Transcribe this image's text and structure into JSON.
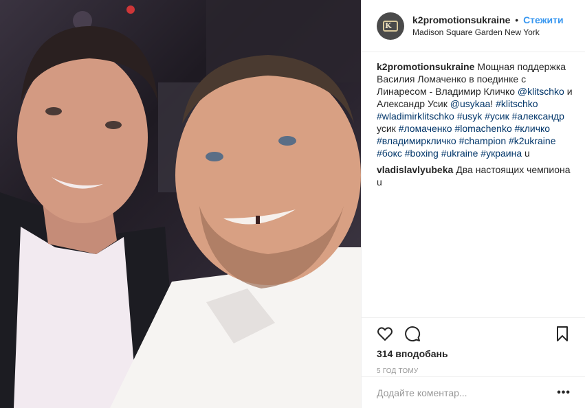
{
  "header": {
    "username": "k2promotionsukraine",
    "separator": "•",
    "follow_label": "Стежити",
    "location": "Madison Square Garden New York"
  },
  "caption": {
    "username": "k2promotionsukraine",
    "text_before": "Мощная поддержка Василия Ломаченко в поединке с Линаресом - Владимир Кличко ",
    "mention1": "@klitschko",
    "text_mid": " и Александр Усик ",
    "mention2": "@usykaa",
    "text_after": "! ",
    "hashtags": [
      "#klitschko",
      "#wladimirklitschko",
      "#usyk",
      "#усик",
      "#александр",
      "усик",
      "#ломаченко",
      "#lomachenko",
      "#кличко",
      "#владимиркличко",
      "#champion",
      "#k2ukraine",
      "#бокс",
      "#boxing",
      "#ukraine",
      "#украина"
    ],
    "end_text": "u"
  },
  "comment2": {
    "username": "vladislavlyubeka",
    "text": "Два настоящих чемпиона u"
  },
  "actions": {
    "likes": "314 вподобань",
    "time": "5 год тому"
  },
  "add_comment": {
    "placeholder": "Додайте коментар...",
    "more": "•••"
  },
  "icons": {
    "like": "heart-icon",
    "comment": "comment-icon",
    "save": "bookmark-icon",
    "options": "ellipsis-icon"
  }
}
